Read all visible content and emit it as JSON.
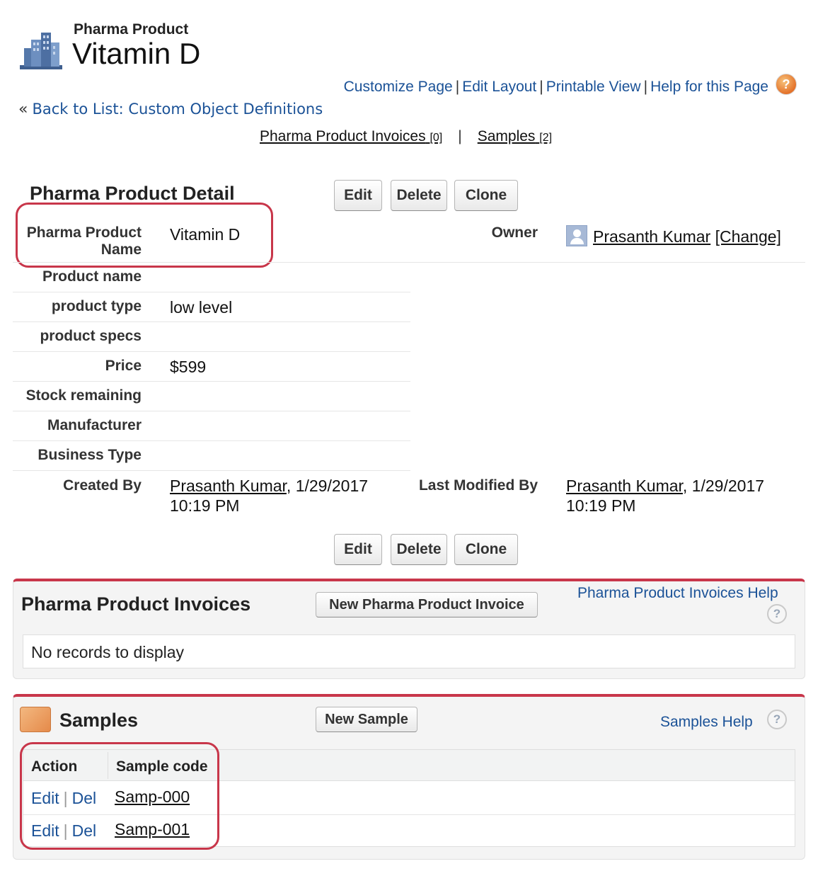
{
  "header": {
    "object_type": "Pharma Product",
    "record_name": "Vitamin D"
  },
  "page_links": {
    "customize": "Customize Page",
    "edit_layout": "Edit Layout",
    "printable": "Printable View",
    "help": "Help for this Page",
    "separator": "|"
  },
  "back": {
    "prefix": "«",
    "label": "Back to List: Custom Object Definitions"
  },
  "related_links": [
    {
      "label": "Pharma Product Invoices",
      "count": "[0]"
    },
    {
      "label": "Samples",
      "count": "[2]"
    }
  ],
  "related_sep": "|",
  "detail": {
    "title": "Pharma Product Detail",
    "buttons": {
      "edit": "Edit",
      "delete": "Delete",
      "clone": "Clone"
    },
    "fields": {
      "name_label": "Pharma Product Name",
      "name_value": "Vitamin D",
      "owner_label": "Owner",
      "owner_value": "Prasanth Kumar",
      "owner_change": "[Change]",
      "product_name_label": "Product name",
      "product_type_label": "product type",
      "product_type_value": "low level",
      "product_specs_label": "product specs",
      "price_label": "Price",
      "price_value": "$599",
      "stock_label": "Stock remaining",
      "manufacturer_label": "Manufacturer",
      "business_type_label": "Business Type",
      "created_by_label": "Created By",
      "created_by_user": "Prasanth Kumar",
      "created_by_date": ", 1/29/2017",
      "created_by_time": "10:19 PM",
      "modified_by_label": "Last Modified By",
      "modified_by_user": "Prasanth Kumar",
      "modified_by_date": ", 1/29/2017",
      "modified_by_time": "10:19 PM"
    }
  },
  "invoices": {
    "title": "Pharma Product Invoices",
    "new_button": "New Pharma Product Invoice",
    "help": "Pharma Product Invoices Help",
    "help_mark": "?",
    "empty": "No records to display"
  },
  "samples": {
    "title": "Samples",
    "new_button": "New Sample",
    "help": "Samples Help",
    "help_mark": "?",
    "columns": [
      "Action",
      "Sample code"
    ],
    "rows": [
      {
        "edit": "Edit",
        "sep": "|",
        "del": "Del",
        "code": "Samp-000"
      },
      {
        "edit": "Edit",
        "sep": "|",
        "del": "Del",
        "code": "Samp-001"
      }
    ]
  },
  "colors": {
    "accent_red": "#c8364a",
    "link_blue": "#1b5297"
  }
}
